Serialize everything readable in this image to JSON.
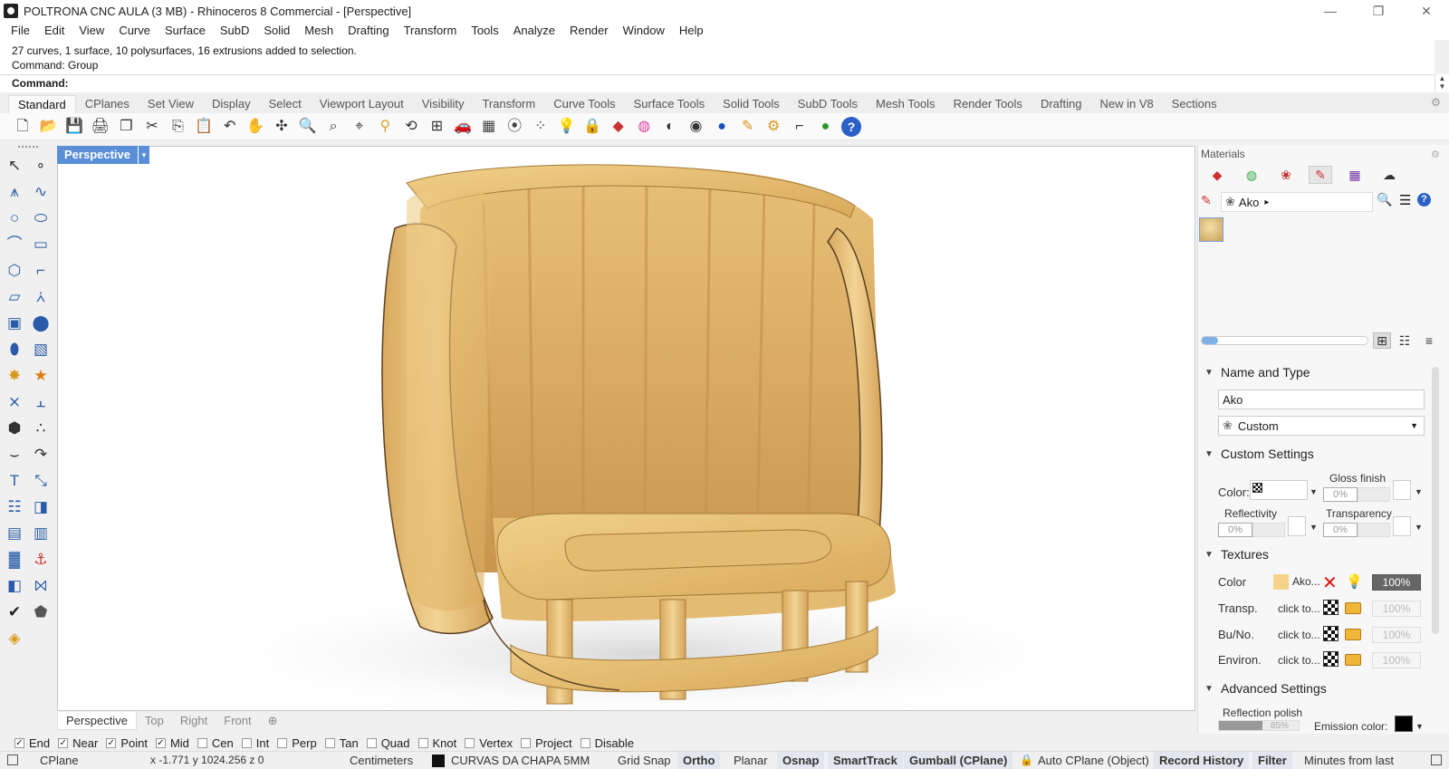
{
  "window": {
    "title": "POLTRONA CNC AULA (3 MB) - Rhinoceros 8 Commercial - [Perspective]",
    "minimize": "—",
    "restore": "❐",
    "close": "✕"
  },
  "menu": [
    "File",
    "Edit",
    "View",
    "Curve",
    "Surface",
    "SubD",
    "Solid",
    "Mesh",
    "Drafting",
    "Transform",
    "Tools",
    "Analyze",
    "Render",
    "Window",
    "Help"
  ],
  "command": {
    "history": [
      "27 curves, 1 surface, 10 polysurfaces, 16 extrusions added to selection.",
      "Command: Group"
    ],
    "prompt": "Command:"
  },
  "toolbar_tabs": [
    "Standard",
    "CPlanes",
    "Set View",
    "Display",
    "Select",
    "Viewport Layout",
    "Visibility",
    "Transform",
    "Curve Tools",
    "Surface Tools",
    "Solid Tools",
    "SubD Tools",
    "Mesh Tools",
    "Render Tools",
    "Drafting",
    "New in V8",
    "Sections"
  ],
  "standard_tools": [
    {
      "name": "new-file-icon",
      "glyph": "🗋",
      "color": "#333333"
    },
    {
      "name": "open-icon",
      "glyph": "📂",
      "color": "#d89a1e"
    },
    {
      "name": "save-icon",
      "glyph": "💾",
      "color": "#333333"
    },
    {
      "name": "print-icon",
      "glyph": "🖨",
      "color": "#333333"
    },
    {
      "name": "properties-icon",
      "glyph": "❐",
      "color": "#333333"
    },
    {
      "name": "cut-icon",
      "glyph": "✂",
      "color": "#333333"
    },
    {
      "name": "copy-icon",
      "glyph": "⎘",
      "color": "#333333"
    },
    {
      "name": "paste-icon",
      "glyph": "📋",
      "color": "#d8a030"
    },
    {
      "name": "undo-icon",
      "glyph": "↶",
      "color": "#333333"
    },
    {
      "name": "pan-icon",
      "glyph": "✋",
      "color": "#333333"
    },
    {
      "name": "rotate-view-icon",
      "glyph": "✣",
      "color": "#333333"
    },
    {
      "name": "zoom-icon",
      "glyph": "🔍",
      "color": "#333333"
    },
    {
      "name": "zoom-window-icon",
      "glyph": "⌕",
      "color": "#333333"
    },
    {
      "name": "zoom-extents-icon",
      "glyph": "⌖",
      "color": "#333333"
    },
    {
      "name": "zoom-selected-icon",
      "glyph": "⚲",
      "color": "#d8a030"
    },
    {
      "name": "undo-view-icon",
      "glyph": "⟲",
      "color": "#333333"
    },
    {
      "name": "four-viewports-icon",
      "glyph": "⊞",
      "color": "#333333"
    },
    {
      "name": "car-icon",
      "glyph": "🚗",
      "color": "#cc2222"
    },
    {
      "name": "grid-plane-icon",
      "glyph": "▦",
      "color": "#444444"
    },
    {
      "name": "osnap-icon",
      "glyph": "⦿",
      "color": "#444444"
    },
    {
      "name": "select-points-icon",
      "glyph": "⁘",
      "color": "#444444"
    },
    {
      "name": "light-bulb-icon",
      "glyph": "💡",
      "color": "#444444"
    },
    {
      "name": "lock-icon",
      "glyph": "🔒",
      "color": "#444444"
    },
    {
      "name": "material-icon",
      "glyph": "◆",
      "color": "#cc3333"
    },
    {
      "name": "color-wheel-icon",
      "glyph": "◍",
      "color": "#e040a0"
    },
    {
      "name": "shaded-sphere-icon",
      "glyph": "◐",
      "color": "#333333"
    },
    {
      "name": "rendered-sphere-icon",
      "glyph": "◉",
      "color": "#333333"
    },
    {
      "name": "render-sphere-icon",
      "glyph": "●",
      "color": "#1a4fc0"
    },
    {
      "name": "pencil-flag-icon",
      "glyph": "✎",
      "color": "#d89a1e"
    },
    {
      "name": "gear-options-icon",
      "glyph": "⚙",
      "color": "#d89a1e"
    },
    {
      "name": "dimension-icon",
      "glyph": "⌐",
      "color": "#333333"
    },
    {
      "name": "green-globe-icon",
      "glyph": "●",
      "color": "#2a9a2a"
    },
    {
      "name": "help-icon",
      "glyph": "?",
      "color": "#ffffff"
    }
  ],
  "left_tools": [
    {
      "name": "select-arrow-icon",
      "glyph": "↖",
      "color": "#333333"
    },
    {
      "name": "point-icon",
      "glyph": "∘",
      "color": "#333333"
    },
    {
      "name": "polyline-icon",
      "glyph": "⩚",
      "color": "#2a5ba8"
    },
    {
      "name": "curve-cv-icon",
      "glyph": "∿",
      "color": "#2a5ba8"
    },
    {
      "name": "circle-icon",
      "glyph": "○",
      "color": "#2a5ba8"
    },
    {
      "name": "ellipse-icon",
      "glyph": "⬭",
      "color": "#2a5ba8"
    },
    {
      "name": "arc-icon",
      "glyph": "⌒",
      "color": "#2a5ba8"
    },
    {
      "name": "rectangle-icon",
      "glyph": "▭",
      "color": "#2a5ba8"
    },
    {
      "name": "polygon-icon",
      "glyph": "⬡",
      "color": "#2a5ba8"
    },
    {
      "name": "fillet-curve-icon",
      "glyph": "⌐",
      "color": "#2a5ba8"
    },
    {
      "name": "surface-corner-icon",
      "glyph": "▱",
      "color": "#2a5ba8"
    },
    {
      "name": "surface-edge-icon",
      "glyph": "⩑",
      "color": "#2a5ba8"
    },
    {
      "name": "box-solid-icon",
      "glyph": "▣",
      "color": "#2a5ba8"
    },
    {
      "name": "boolean-union-icon",
      "glyph": "⬤",
      "color": "#2a5ba8"
    },
    {
      "name": "cylinder-icon",
      "glyph": "⬮",
      "color": "#2a5ba8"
    },
    {
      "name": "mesh-plane-icon",
      "glyph": "▧",
      "color": "#2a5ba8"
    },
    {
      "name": "gear-star-icon",
      "glyph": "✸",
      "color": "#d89a1e"
    },
    {
      "name": "explode-icon",
      "glyph": "★",
      "color": "#e07a10"
    },
    {
      "name": "split-icon",
      "glyph": "⨯",
      "color": "#2a5ba8"
    },
    {
      "name": "trim-icon",
      "glyph": "⫠",
      "color": "#2a5ba8"
    },
    {
      "name": "group-icon",
      "glyph": "⬢",
      "color": "#333333"
    },
    {
      "name": "ungroup-icon",
      "glyph": "∴",
      "color": "#333333"
    },
    {
      "name": "bend-icon",
      "glyph": "⌣",
      "color": "#333333"
    },
    {
      "name": "twist-icon",
      "glyph": "↷",
      "color": "#333333"
    },
    {
      "name": "text-icon",
      "glyph": "T",
      "color": "#2a5ba8"
    },
    {
      "name": "dimension-linear-icon",
      "glyph": "⤡",
      "color": "#2a5ba8"
    },
    {
      "name": "array-icon",
      "glyph": "☷",
      "color": "#2a5ba8"
    },
    {
      "name": "flow-along-icon",
      "glyph": "◨",
      "color": "#2a5ba8"
    },
    {
      "name": "block-icon",
      "glyph": "▤",
      "color": "#2a5ba8"
    },
    {
      "name": "polar-array-icon",
      "glyph": "▥",
      "color": "#2a5ba8"
    },
    {
      "name": "grid-array-icon",
      "glyph": "▓",
      "color": "#2a5ba8"
    },
    {
      "name": "gumball-icon",
      "glyph": "⚓",
      "color": "#cc3333"
    },
    {
      "name": "project-icon",
      "glyph": "◧",
      "color": "#2a5ba8"
    },
    {
      "name": "analyze-icon",
      "glyph": "⨝",
      "color": "#2a5ba8"
    },
    {
      "name": "check-icon",
      "glyph": "✔",
      "color": "#222222"
    },
    {
      "name": "mesh-solid-icon",
      "glyph": "⬟",
      "color": "#555555"
    },
    {
      "name": "paint-bucket-icon",
      "glyph": "◈",
      "color": "#d89a1e"
    }
  ],
  "viewport": {
    "label": "Perspective",
    "dropdown": "▾",
    "tabs": [
      "Perspective",
      "Top",
      "Right",
      "Front"
    ],
    "add_tab": "⊕"
  },
  "materials_panel": {
    "title": "Materials",
    "gear": "⚙",
    "tabs": [
      {
        "name": "materials-tab",
        "glyph": "◆",
        "color": "#cc3333"
      },
      {
        "name": "environments-tab",
        "glyph": "◍",
        "color": "#2aa840"
      },
      {
        "name": "textures-tab",
        "glyph": "❀",
        "color": "#c03030"
      },
      {
        "name": "material-editor-tab",
        "glyph": "✎",
        "color": "#cc3333"
      },
      {
        "name": "color-palette-tab",
        "glyph": "▦",
        "color": "#7030a0"
      },
      {
        "name": "ground-plane-tab",
        "glyph": "☁",
        "color": "#333333"
      }
    ],
    "editor_icon": "✎",
    "material_type_icon": "❀",
    "selected_material": "Ako",
    "breadcrumb_arrow": "▸",
    "search": "🔍",
    "menu": "☰",
    "help": "?",
    "view_modes": [
      "⊞",
      "☷",
      "≡"
    ],
    "name_and_type": {
      "header": "Name and Type",
      "name": "Ako",
      "type": "Custom",
      "type_icon": "❀"
    },
    "custom_settings": {
      "header": "Custom Settings",
      "color_label": "Color:",
      "gloss_label": "Gloss finish",
      "gloss_value": "0%",
      "reflectivity_label": "Reflectivity",
      "reflectivity_value": "0%",
      "transparency_label": "Transparency",
      "transparency_value": "0%"
    },
    "textures": {
      "header": "Textures",
      "rows": [
        {
          "label": "Color",
          "value": "Ako...",
          "amount": "100%"
        },
        {
          "label": "Transp.",
          "value": "click to...",
          "amount": "100%"
        },
        {
          "label": "Bu/No.",
          "value": "click to...",
          "amount": "100%"
        },
        {
          "label": "Environ.",
          "value": "click to...",
          "amount": "100%"
        }
      ],
      "remove_icon": "✕",
      "bulb_icon": "💡"
    },
    "advanced_settings": {
      "header": "Advanced Settings",
      "reflection_polish_label": "Reflection polish",
      "reflection_polish_value": "85%",
      "emission_label": "Emission color:"
    },
    "colors": {
      "texture_swatch": "#f5d38a",
      "emission": "#000000",
      "wood": "#e8c27a"
    }
  },
  "osnaps": [
    {
      "label": "End",
      "checked": true
    },
    {
      "label": "Near",
      "checked": true
    },
    {
      "label": "Point",
      "checked": true
    },
    {
      "label": "Mid",
      "checked": true
    },
    {
      "label": "Cen",
      "checked": false
    },
    {
      "label": "Int",
      "checked": false
    },
    {
      "label": "Perp",
      "checked": false
    },
    {
      "label": "Tan",
      "checked": false
    },
    {
      "label": "Quad",
      "checked": false
    },
    {
      "label": "Knot",
      "checked": false
    },
    {
      "label": "Vertex",
      "checked": false
    },
    {
      "label": "Project",
      "checked": false
    },
    {
      "label": "Disable",
      "checked": false
    }
  ],
  "status": {
    "cplane": "CPlane",
    "coords": "x -1.771  y 1024.256  z 0",
    "units": "Centimeters",
    "layer": "CURVAS DA CHAPA 5MM",
    "layer_color": "#111111",
    "grid_snap": "Grid Snap",
    "ortho": "Ortho",
    "planar": "Planar",
    "osnap": "Osnap",
    "smarttrack": "SmartTrack",
    "gumball": "Gumball (CPlane)",
    "auto_cplane": "Auto CPlane (Object)",
    "record_history": "Record History",
    "filter": "Filter",
    "minutes": "Minutes from last"
  }
}
